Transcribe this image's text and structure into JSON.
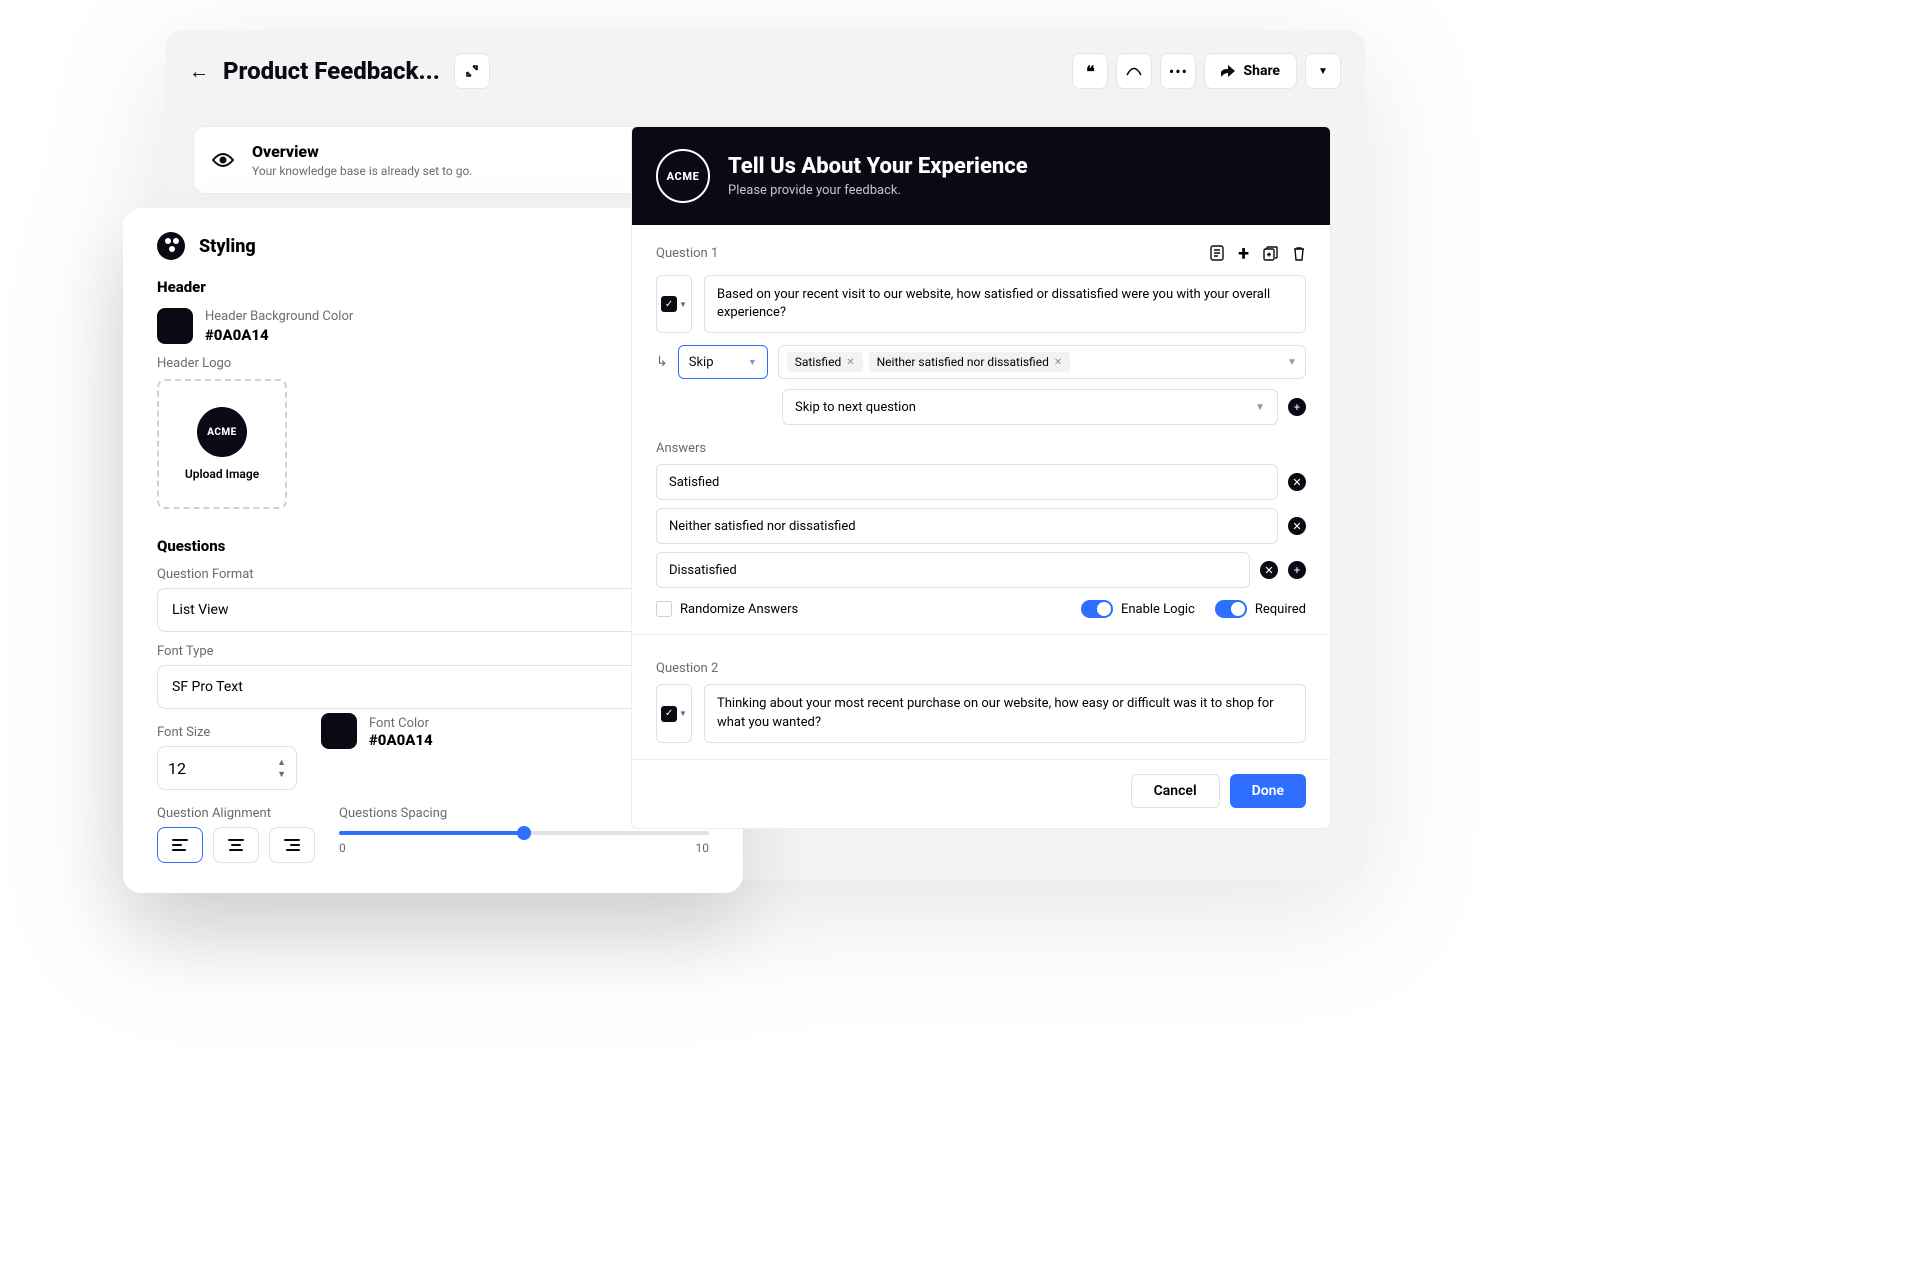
{
  "header": {
    "title": "Product Feedback...",
    "share_label": "Share"
  },
  "overview": {
    "title": "Overview",
    "subtitle": "Your knowledge base is already set to go."
  },
  "styling": {
    "title": "Styling",
    "header_section": "Header",
    "header_bg_label": "Header Background Color",
    "header_bg_value": "#0A0A14",
    "header_logo_label": "Header Logo",
    "logo_text": "ACME",
    "upload_label": "Upload Image",
    "questions_section": "Questions",
    "format_label": "Question Format",
    "format_value": "List View",
    "font_type_label": "Font Type",
    "font_type_value": "SF Pro Text",
    "font_size_label": "Font Size",
    "font_size_value": "12",
    "font_color_label": "Font Color",
    "font_color_value": "#0A0A14",
    "alignment_label": "Question Alignment",
    "spacing_label": "Questions Spacing",
    "spacing_min": "0",
    "spacing_max": "10",
    "spacing_value": 5
  },
  "survey": {
    "logo_text": "ACME",
    "title": "Tell Us About Your Experience",
    "subtitle": "Please provide your feedback.",
    "q1": {
      "label": "Question 1",
      "text": "Based on your recent visit to our website, how satisfied or dissatisfied were you with your overall experience?",
      "skip_label": "Skip",
      "tags": [
        "Satisfied",
        "Neither satisfied nor dissatisfied"
      ],
      "skip_to": "Skip to next question",
      "answers_label": "Answers",
      "answers": [
        "Satisfied",
        "Neither satisfied nor dissatisfied",
        "Dissatisfied"
      ],
      "randomize_label": "Randomize Answers",
      "enable_logic_label": "Enable Logic",
      "required_label": "Required"
    },
    "q2": {
      "label": "Question 2",
      "text": "Thinking about your most recent purchase on our website, how easy or difficult was it to shop for what you wanted?"
    },
    "cancel": "Cancel",
    "done": "Done"
  }
}
